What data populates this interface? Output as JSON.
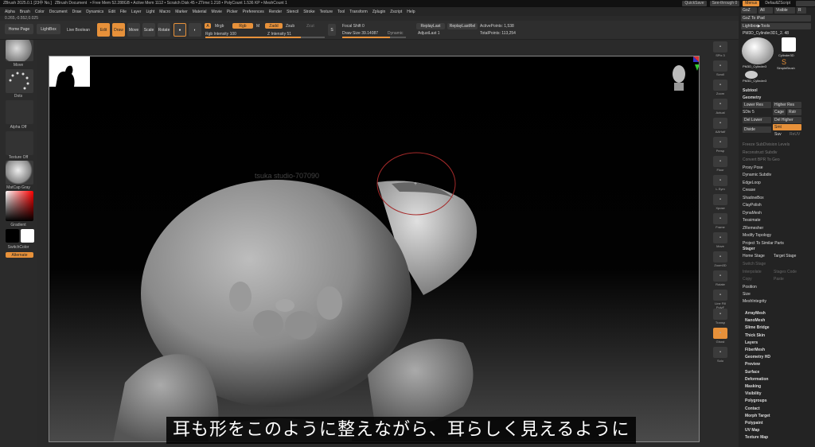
{
  "titlebar": {
    "app": "ZBrush 2025.0.1 [23中 No.]",
    "doc": "ZBrush Document",
    "mem": "• Free Mem 52.288GB • Active Mem 1112 • Scratch Disk 45 • ZTime:1.218 • PolyCount 1.536 KP • MeshCount 1",
    "quicksave": "QuickSave",
    "see_through": "See-through 0",
    "menus": "Menus",
    "script": "DefaultZScript"
  },
  "menubar": [
    "Alpha",
    "Brush",
    "Color",
    "Document",
    "Draw",
    "Dynamics",
    "Edit",
    "File",
    "Layer",
    "Light",
    "Macro",
    "Marker",
    "Material",
    "Movie",
    "Picker",
    "Preferences",
    "Render",
    "Stencil",
    "Stroke",
    "Texture",
    "Tool",
    "Transform",
    "Zplugin",
    "Zscript",
    "Help"
  ],
  "coords": "0.265,-0.552,0.025",
  "toolbar": {
    "home": "Home Page",
    "lightbox": "LightBox",
    "live_boolean": "Live Boolean",
    "edit": "Edit",
    "draw": "Draw",
    "move": "Move",
    "scale": "Scale",
    "rotate": "Rotate",
    "a": "A",
    "mrgb": "Mrgb",
    "rgb": "Rgb",
    "m": "M",
    "zadd": "Zadd",
    "zsub": "Zsub",
    "zcut": "Zcut",
    "rgb_intensity_label": "Rgb Intensity",
    "rgb_intensity": "100",
    "z_intensity_label": "Z Intensity",
    "z_intensity": "51",
    "focal_label": "Focal Shift",
    "focal": "0",
    "draw_size_label": "Draw Size",
    "draw_size": "39.14087",
    "dynamic": "Dynamic",
    "replay_last": "ReplayLast",
    "replay_last_rel": "ReplayLastRel",
    "adjust_label": "AdjustLast",
    "adjust": "1",
    "active_points_label": "ActivePoints:",
    "active_points": "1,538",
    "total_points_label": "TotalPoints:",
    "total_points": "113,254"
  },
  "left": {
    "brush": "Move",
    "stroke": "Dots",
    "alpha": "Alpha Off",
    "texture": "Texture Off",
    "material": "MatCap Gray",
    "gradient": "Gradient",
    "switch": "SwitchColor",
    "alternate": "Alternate"
  },
  "vtools": [
    "SPix 3",
    "Scroll",
    "Zoom",
    "Actual",
    "AAHalf",
    "Persp",
    "Floor",
    "L.Sym",
    "Xpose",
    "Frame",
    "Move",
    "Zoom3D",
    "Rotate",
    "Line Fill PolyF",
    "Transp",
    "Ghost",
    "Solo"
  ],
  "right": {
    "top_buttons": [
      "GoZ",
      "All",
      "Visible",
      "R"
    ],
    "goz_to_ipad": "GoZ To iPad",
    "lightbox_tools": "Lightbox▶Tools",
    "tool_name": "PM3D_Cylinder3D1_2",
    "tool_count": "48",
    "thumbs": [
      "PM3D_Cylinder3",
      "Cylinder3D",
      "SimpleBrush",
      "PM3D_Cylinder3"
    ],
    "subtool": "Subtool",
    "geometry": "Geometry",
    "lower_res": "Lower Res",
    "higher_res": "Higher Res",
    "sdiv": "SDiv",
    "sdiv_val": "5",
    "cage": "Cage",
    "rstr": "Rstr",
    "del_lower": "Del Lower",
    "del_higher": "Del Higher",
    "divide": "Divide",
    "smt": "Smt",
    "suv": "Suv",
    "reuv": "ReUV",
    "items": [
      "Freeze SubDivision Levels",
      "Reconstruct Subdiv",
      "Convert BPR To Geo",
      "Proxy Pose",
      "Dynamic Subdiv",
      "EdgeLoop",
      "Crease",
      "ShadowBox",
      "ClayPolish",
      "DynaMesh",
      "Tessimate",
      "ZRemesher",
      "Modify Topology",
      "Project To Similar Parts"
    ],
    "stager": "Stager",
    "home_stage": "Home Stage",
    "target_stage": "Target Stage",
    "switch_stage": "Switch Stage",
    "interpolate": "Interpolate",
    "stages_code": "Stages Code",
    "copy": "Copy",
    "paste": "Paste",
    "position": "Position",
    "size": "Size",
    "meshintegrity": "MeshIntegrity",
    "sections": [
      "ArrayMesh",
      "NanoMesh",
      "Slime Bridge",
      "Thick Skin",
      "Layers",
      "FiberMesh",
      "Geometry HD",
      "Preview",
      "Surface",
      "Deformation",
      "Masking",
      "Visibility",
      "Polygroups",
      "Contact",
      "Morph Target",
      "Polypaint",
      "UV Map",
      "Texture Map"
    ]
  },
  "canvas": {
    "watermark": "tsuka studio-707090"
  },
  "subtitle": "耳も形をこのように整えながら、耳らしく見えるように",
  "colors": {
    "accent": "#e7913a",
    "bg": "#2a2a2a"
  }
}
